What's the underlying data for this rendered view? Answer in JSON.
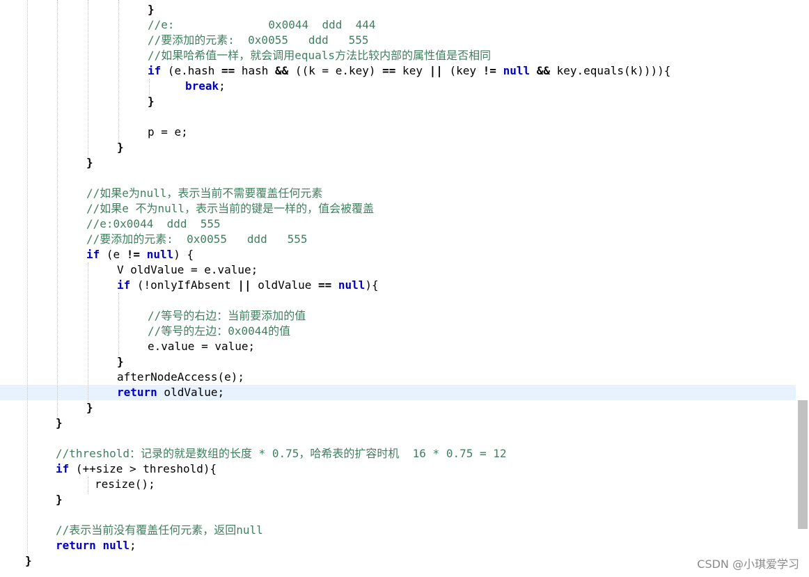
{
  "lines": [
    [
      {
        "t": "}",
        "c": "op"
      }
    ],
    [
      {
        "t": "//e:              0x0044  ddd  444",
        "c": "cm"
      }
    ],
    [
      {
        "t": "//要添加的元素:  0x0055   ddd   555",
        "c": "cm"
      }
    ],
    [
      {
        "t": "//如果哈希值一样，就会调用equals方法比较内部的属性值是否相同",
        "c": "cm"
      }
    ],
    [
      {
        "t": "if",
        "c": "kw"
      },
      {
        "t": " (e.hash ",
        "c": "plain"
      },
      {
        "t": "==",
        "c": "op"
      },
      {
        "t": " hash ",
        "c": "plain"
      },
      {
        "t": "&&",
        "c": "op"
      },
      {
        "t": " ((k = e.key) ",
        "c": "plain"
      },
      {
        "t": "==",
        "c": "op"
      },
      {
        "t": " key ",
        "c": "plain"
      },
      {
        "t": "||",
        "c": "op"
      },
      {
        "t": " (key ",
        "c": "plain"
      },
      {
        "t": "!=",
        "c": "op"
      },
      {
        "t": " ",
        "c": "plain"
      },
      {
        "t": "null",
        "c": "kw"
      },
      {
        "t": " ",
        "c": "plain"
      },
      {
        "t": "&&",
        "c": "op"
      },
      {
        "t": " key.equals(k)))){",
        "c": "plain"
      }
    ],
    [
      {
        "t": "break",
        "c": "kw"
      },
      {
        "t": ";",
        "c": "plain"
      }
    ],
    [
      {
        "t": "}",
        "c": "op"
      }
    ],
    [],
    [
      {
        "t": "p = e;",
        "c": "plain"
      }
    ],
    [
      {
        "t": "}",
        "c": "op"
      }
    ],
    [
      {
        "t": "}",
        "c": "op"
      }
    ],
    [],
    [
      {
        "t": "//如果e为null，表示当前不需要覆盖任何元素",
        "c": "cm"
      }
    ],
    [
      {
        "t": "//如果e 不为null，表示当前的键是一样的，值会被覆盖",
        "c": "cm"
      }
    ],
    [
      {
        "t": "//e:0x0044  ddd  555",
        "c": "cm"
      }
    ],
    [
      {
        "t": "//要添加的元素:  0x0055   ddd   555",
        "c": "cm"
      }
    ],
    [
      {
        "t": "if",
        "c": "kw"
      },
      {
        "t": " (e ",
        "c": "plain"
      },
      {
        "t": "!=",
        "c": "op"
      },
      {
        "t": " ",
        "c": "plain"
      },
      {
        "t": "null",
        "c": "kw"
      },
      {
        "t": ") {",
        "c": "plain"
      }
    ],
    [
      {
        "t": "V oldValue = e.value;",
        "c": "plain"
      }
    ],
    [
      {
        "t": "if",
        "c": "kw"
      },
      {
        "t": " (!onlyIfAbsent ",
        "c": "plain"
      },
      {
        "t": "||",
        "c": "op"
      },
      {
        "t": " oldValue ",
        "c": "plain"
      },
      {
        "t": "==",
        "c": "op"
      },
      {
        "t": " ",
        "c": "plain"
      },
      {
        "t": "null",
        "c": "kw"
      },
      {
        "t": "){",
        "c": "plain"
      }
    ],
    [],
    [
      {
        "t": "//等号的右边：当前要添加的值",
        "c": "cm"
      }
    ],
    [
      {
        "t": "//等号的左边：0x0044的值",
        "c": "cm"
      }
    ],
    [
      {
        "t": "e.value = value;",
        "c": "plain"
      }
    ],
    [
      {
        "t": "}",
        "c": "op"
      }
    ],
    [
      {
        "t": "afterNodeAccess(e);",
        "c": "plain"
      }
    ],
    [
      {
        "t": "return",
        "c": "kw"
      },
      {
        "t": " oldValue;",
        "c": "plain"
      }
    ],
    [
      {
        "t": "}",
        "c": "op"
      }
    ],
    [
      {
        "t": "}",
        "c": "op"
      }
    ],
    [],
    [
      {
        "t": "//threshold：记录的就是数组的长度 * 0.75，哈希表的扩容时机  16 * 0.75 = 12",
        "c": "cm"
      }
    ],
    [
      {
        "t": "if",
        "c": "kw"
      },
      {
        "t": " (++size > threshold){",
        "c": "plain"
      }
    ],
    [
      {
        "t": "resize();",
        "c": "plain"
      }
    ],
    [
      {
        "t": "}",
        "c": "op"
      }
    ],
    [],
    [
      {
        "t": "//表示当前没有覆盖任何元素，返回null",
        "c": "cm"
      }
    ],
    [
      {
        "t": "return",
        "c": "kw"
      },
      {
        "t": " ",
        "c": "plain"
      },
      {
        "t": "null",
        "c": "kw"
      },
      {
        "t": ";",
        "c": "plain"
      }
    ],
    [
      {
        "t": "}",
        "c": "op"
      }
    ]
  ],
  "watermark": "CSDN @小琪爱学习"
}
